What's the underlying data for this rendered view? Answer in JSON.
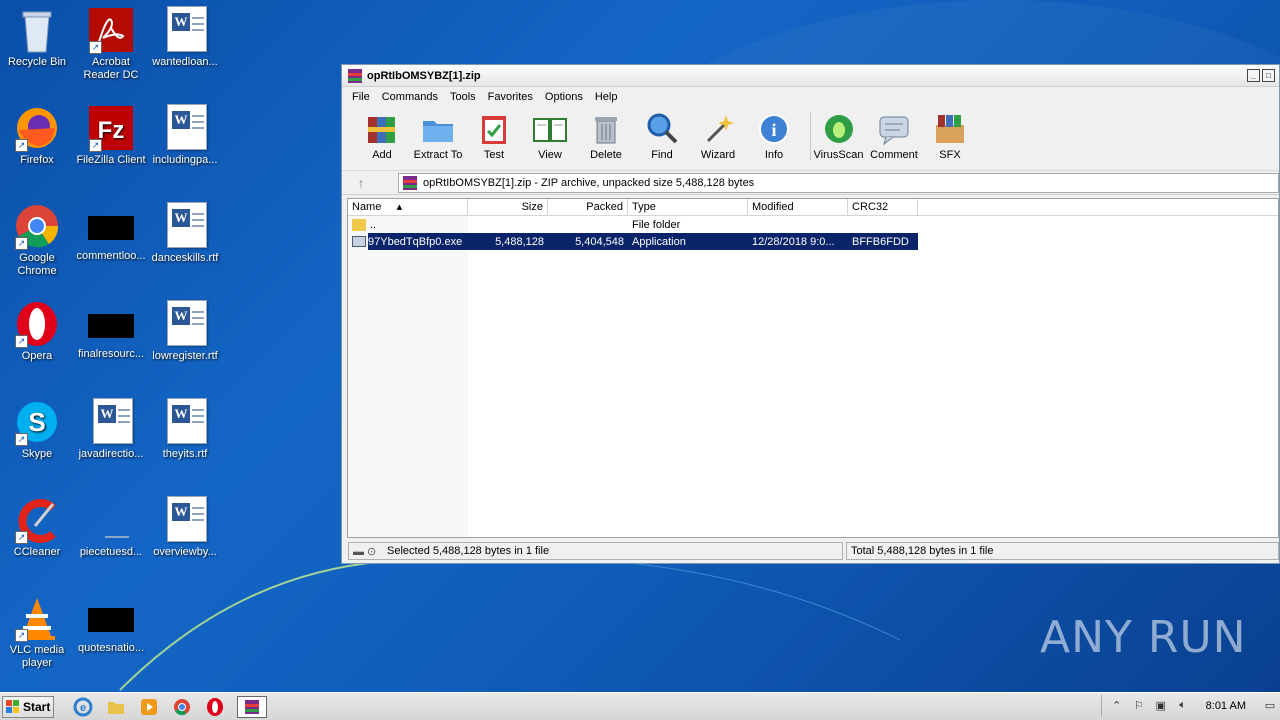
{
  "desktop": {
    "icons": [
      {
        "label": "Recycle Bin"
      },
      {
        "label": "Acrobat Reader DC"
      },
      {
        "label": "wantedloan..."
      },
      {
        "label": "Firefox"
      },
      {
        "label": "FileZilla Client"
      },
      {
        "label": "includingpa..."
      },
      {
        "label": "Google Chrome"
      },
      {
        "label": "commentloo..."
      },
      {
        "label": "danceskills.rtf"
      },
      {
        "label": "Opera"
      },
      {
        "label": "finalresourc..."
      },
      {
        "label": "lowregister.rtf"
      },
      {
        "label": "Skype"
      },
      {
        "label": "javadirectio..."
      },
      {
        "label": "theyits.rtf"
      },
      {
        "label": "CCleaner"
      },
      {
        "label": "piecetuesd..."
      },
      {
        "label": "overviewby..."
      },
      {
        "label": "VLC media player"
      },
      {
        "label": "quotesnatio..."
      }
    ]
  },
  "window": {
    "title": "opRtIbOMSYBZ[1].zip",
    "menu": [
      "File",
      "Commands",
      "Tools",
      "Favorites",
      "Options",
      "Help"
    ],
    "toolbar": [
      "Add",
      "Extract To",
      "Test",
      "View",
      "Delete",
      "Find",
      "Wizard",
      "Info",
      "VirusScan",
      "Comment",
      "SFX"
    ],
    "address": "opRtIbOMSYBZ[1].zip - ZIP archive, unpacked size 5,488,128 bytes",
    "columns": {
      "name": "Name",
      "size": "Size",
      "packed": "Packed",
      "type": "Type",
      "modified": "Modified",
      "crc": "CRC32"
    },
    "rows": [
      {
        "name": "..",
        "size": "",
        "packed": "",
        "type": "File folder",
        "modified": "",
        "crc": ""
      },
      {
        "name": "97YbedTqBfp0.exe",
        "size": "5,488,128",
        "packed": "5,404,548",
        "type": "Application",
        "modified": "12/28/2018 9:0...",
        "crc": "BFFB6FDD"
      }
    ],
    "status_left": "Selected 5,488,128 bytes in 1 file",
    "status_right": "Total 5,488,128 bytes in 1 file"
  },
  "taskbar": {
    "start_label": "Start",
    "clock": "8:01 AM"
  },
  "watermark": "ANY RUN"
}
